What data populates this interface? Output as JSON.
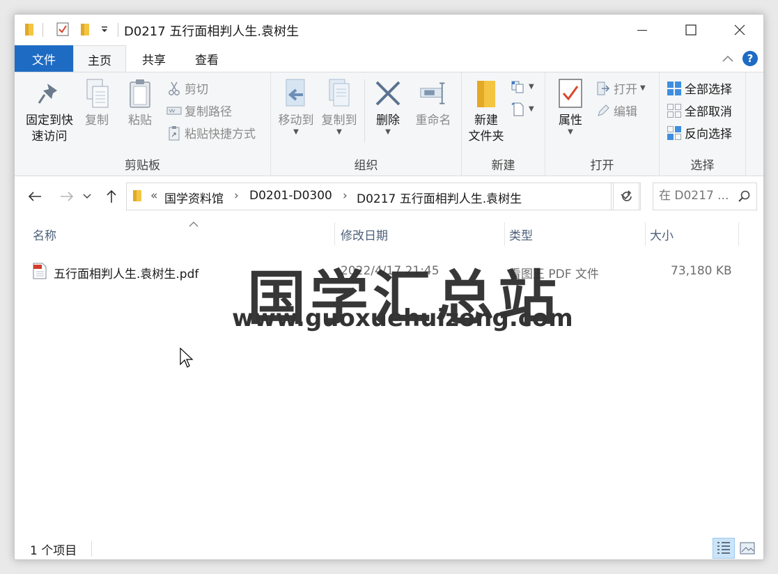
{
  "window": {
    "title": "D0217 五行面相判人生.袁树生"
  },
  "tabs": {
    "file": "文件",
    "home": "主页",
    "share": "共享",
    "view": "查看"
  },
  "help_symbol": "?",
  "ribbon": {
    "clipboard": {
      "label": "剪贴板",
      "pin_line1": "固定到快",
      "pin_line2": "速访问",
      "copy": "复制",
      "paste": "粘贴",
      "cut": "剪切",
      "copy_path": "复制路径",
      "paste_shortcut": "粘贴快捷方式"
    },
    "organize": {
      "label": "组织",
      "move_to": "移动到",
      "copy_to": "复制到",
      "delete": "删除",
      "rename": "重命名"
    },
    "new": {
      "label": "新建",
      "new_folder_line1": "新建",
      "new_folder_line2": "文件夹"
    },
    "open": {
      "label": "打开",
      "properties": "属性",
      "open": "打开",
      "edit": "编辑"
    },
    "select": {
      "label": "选择",
      "select_all": "全部选择",
      "select_none": "全部取消",
      "invert": "反向选择"
    }
  },
  "address": {
    "overflow": "«",
    "crumbs": [
      "国学资料馆",
      "D0201-D0300",
      "D0217 五行面相判人生.袁树生"
    ],
    "separator": "›"
  },
  "search": {
    "placeholder": "在 D0217 ..."
  },
  "columns": {
    "name": "名称",
    "modified": "修改日期",
    "type": "类型",
    "size": "大小"
  },
  "files": [
    {
      "name": "五行面相判人生.袁树生.pdf",
      "modified": "2022/4/17 21:45",
      "type": "看图王 PDF 文件",
      "size": "73,180 KB",
      "icon": "pdf-file-icon"
    }
  ],
  "watermark": {
    "cn": "国学汇总站",
    "url": "www.guoxuehuizong.com"
  },
  "status": {
    "count": "1 个项目"
  },
  "colors": {
    "accent": "#1e6bc4",
    "folder": "#f4c542",
    "ribbon_bg": "#f5f6f7"
  }
}
